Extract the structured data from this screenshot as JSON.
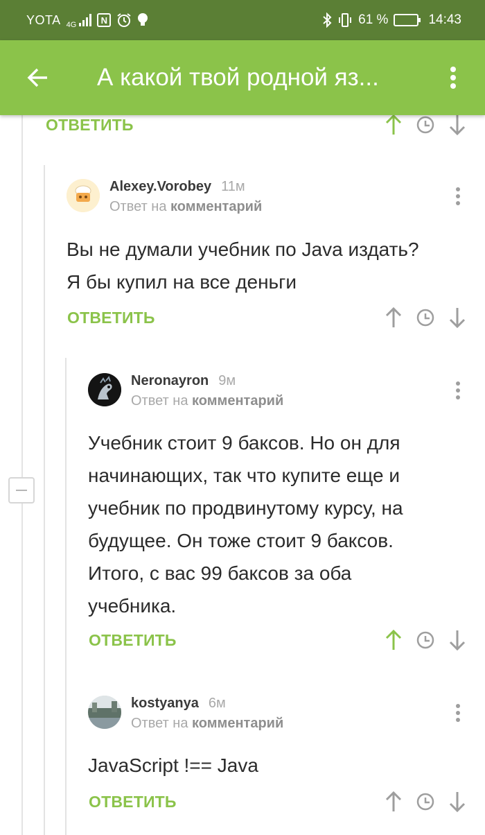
{
  "status_bar": {
    "operator": "YOTA",
    "network": "4G",
    "battery_level": "61 %",
    "battery_fraction": 0.61,
    "time": "14:43",
    "icons": [
      "signal-icon",
      "nfc-icon",
      "alarm-icon",
      "bulb-icon",
      "bluetooth-icon",
      "vibrate-icon",
      "battery-icon"
    ]
  },
  "app_bar": {
    "title": "А какой твой родной яз...",
    "back_icon": "arrow-left-icon",
    "menu_icon": "more-vert-icon",
    "background": "#8bc34a",
    "status_background": "#5b7f35"
  },
  "colors": {
    "accent": "#8bc34a",
    "vote_icon": "#9e9e9e",
    "upvoted": "#8bc34a"
  },
  "top_actions": {
    "reply_label": "ОТВЕТИТЬ",
    "upvoted": true
  },
  "comments": [
    {
      "username": "Alexey.Vorobey",
      "age": "11м",
      "reply_prefix": "Ответ на",
      "reply_target": "комментарий",
      "text_lines": [
        "Вы не думали учебник по Java издать?",
        "Я бы купил на все деньги"
      ],
      "reply_label": "ОТВЕТИТЬ",
      "upvoted": false
    },
    {
      "username": "Neronayron",
      "age": "9м",
      "reply_prefix": "Ответ на",
      "reply_target": "комментарий",
      "text_lines": [
        "Учебник стоит 9 баксов. Но он для",
        "начинающих, так что купите еще и",
        "учебник по продвинутому курсу, на",
        "будущее. Он тоже стоит 9 баксов.",
        "Итого, с вас 99 баксов за оба",
        "учебника."
      ],
      "reply_label": "ОТВЕТИТЬ",
      "upvoted": true
    },
    {
      "username": "kostyanya",
      "age": "6м",
      "reply_prefix": "Ответ на",
      "reply_target": "комментарий",
      "text_lines": [
        "JavaScript !== Java"
      ],
      "reply_label": "ОТВЕТИТЬ",
      "upvoted": false
    }
  ]
}
